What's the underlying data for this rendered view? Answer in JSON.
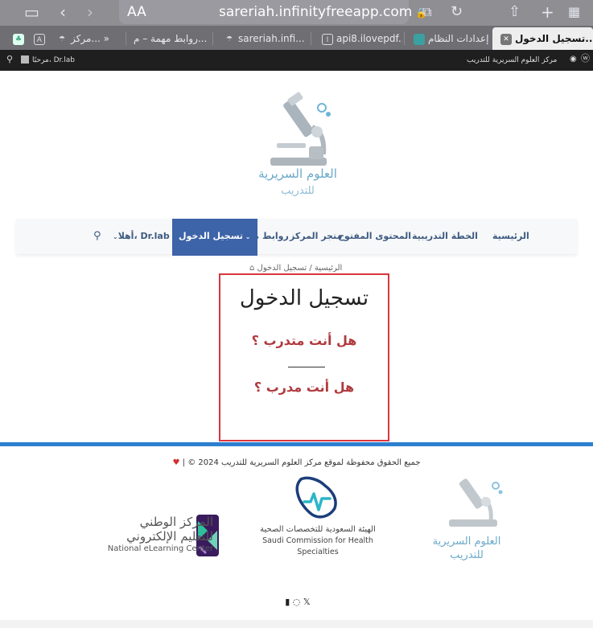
{
  "browser": {
    "text_size_label": "AA",
    "url": "sareriah.infinityfreeapp.com"
  },
  "tabs": [
    {
      "label": "تسجيل الدخول..."
    },
    {
      "label": "إعدادات النظام..."
    },
    {
      "label": "api8.ilovepdf..."
    },
    {
      "label": "sareriah.infi..."
    },
    {
      "label": "روابط مهمة – م..."
    },
    {
      "label": "مركز... »"
    }
  ],
  "wp_admin": {
    "site_name": "مركز العلوم السريرية للتدريب",
    "greeting": "مرحبًا، Dr.lab"
  },
  "logo": {
    "line1": "العلوم السريرية",
    "line2": "للتدريب"
  },
  "nav": {
    "items": [
      "الرئيسية",
      "الخطة التدريبية",
      "المحتوى المفتوح",
      "متجر المركز",
      "روابط مهمة"
    ],
    "active": "تسجيل الدخول",
    "user": "أهلا، Dr.lab"
  },
  "breadcrumb": "الرئيسية / تسجيل الدخول",
  "login": {
    "title": "تسجيل الدخول",
    "trainee_link": "هل أنت متدرب ؟",
    "trainer_link": "هل أنت مدرب ؟"
  },
  "footer": {
    "copyright": "© 2024 جميع الحقوق محفوظة لموقع مركز العلوم السريرية للتدريب",
    "separator": "|",
    "nelc": {
      "ar1": "المركز الوطني",
      "ar2": "للتعليم الإلكتروني",
      "en": "National eLearning Center"
    },
    "scfhs": {
      "ar": "الهيئة السعودية للتخصصات الصحية",
      "en": "Saudi Commission for Health Specialties"
    },
    "logo": {
      "line1": "العلوم السريرية",
      "line2": "للتدريب"
    }
  },
  "colors": {
    "accent": "#3d63a8",
    "login_border": "#d9363e",
    "link_red": "#b03a3e",
    "footer_line": "#2d7fcf"
  }
}
